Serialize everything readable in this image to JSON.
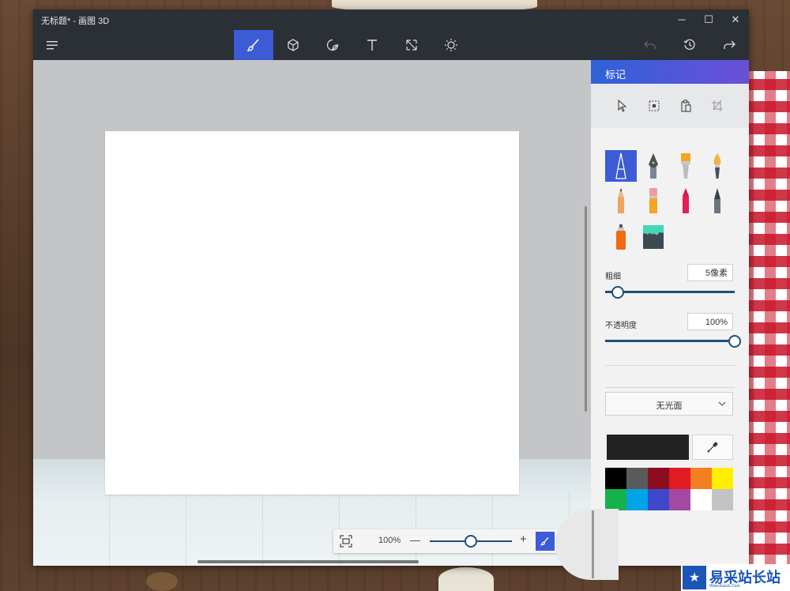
{
  "window": {
    "title": "无标题* - 画图 3D",
    "controls": {
      "minimize": "─",
      "maximize": "☐",
      "close": "✕"
    }
  },
  "toolbar": {
    "tools": [
      {
        "name": "brushes",
        "icon": "brush-icon",
        "active": true
      },
      {
        "name": "3d-shapes",
        "icon": "cube-icon",
        "active": false
      },
      {
        "name": "stickers",
        "icon": "sticker-icon",
        "active": false
      },
      {
        "name": "text",
        "icon": "text-icon",
        "active": false
      },
      {
        "name": "canvas",
        "icon": "resize-icon",
        "active": false
      },
      {
        "name": "effects",
        "icon": "sun-icon",
        "active": false
      }
    ]
  },
  "zoom": {
    "value_label": "100%",
    "minus": "—",
    "plus": "+",
    "level": 0.5
  },
  "panel": {
    "title": "标记",
    "thickness": {
      "label": "粗细",
      "value": "5像素",
      "level": 0.1
    },
    "opacity": {
      "label": "不透明度",
      "value": "100%",
      "level": 1.0
    },
    "finish": {
      "selected": "无光面"
    },
    "current_color": "#222222",
    "palette": [
      [
        "#000000",
        "#5a5a5a",
        "#8b0d1f",
        "#e21b23",
        "#f57e20",
        "#ffee00"
      ],
      [
        "#15b14b",
        "#00a4e6",
        "#3f48cc",
        "#a349a4",
        "#ffffff",
        "#c3c3c3"
      ]
    ]
  },
  "watermark": {
    "icon_text": "★",
    "text": "易采站长站",
    "sub": "Www.Easck.Com"
  },
  "colors": {
    "accent": "#3c5bd4",
    "titlebar": "#2b2f36"
  }
}
